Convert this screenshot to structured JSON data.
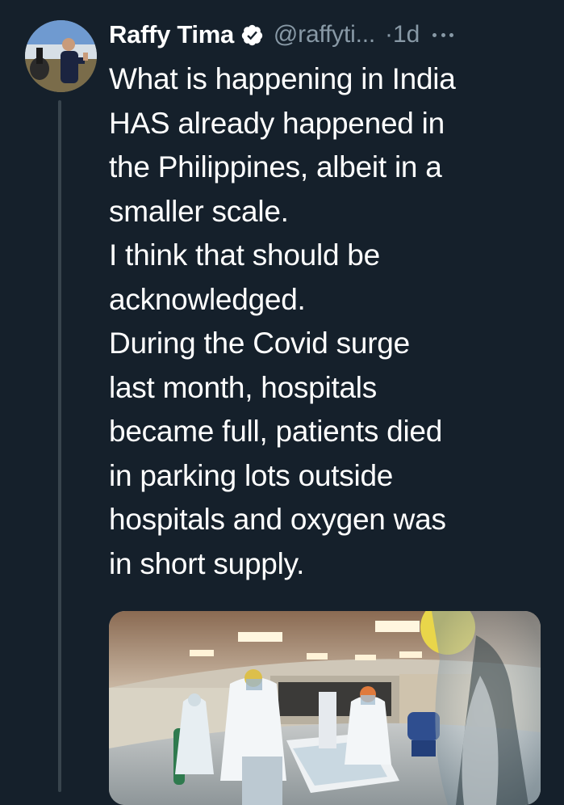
{
  "tweet": {
    "author_name": "Raffy Tima",
    "handle": "@raffyti...",
    "time_sep": "·",
    "time": "1d",
    "verified_icon": "verified-badge-icon",
    "more_icon": "more-options-icon",
    "lines": [
      "What is happening in India",
      "HAS already happened in",
      "the Philippines, albeit in a",
      "smaller scale.",
      "I think that should be",
      "acknowledged.",
      "During the Covid surge",
      "last month, hospitals",
      "became full, patients died",
      "in parking lots outside",
      "hospitals and oxygen was",
      "in short supply."
    ],
    "media": {
      "description_icon": "hospital-photo"
    }
  },
  "colors": {
    "background": "#15202b",
    "text_primary": "#ffffff",
    "text_secondary": "#8899a6",
    "verified": "#ffffff",
    "thread_line": "#38444d"
  }
}
